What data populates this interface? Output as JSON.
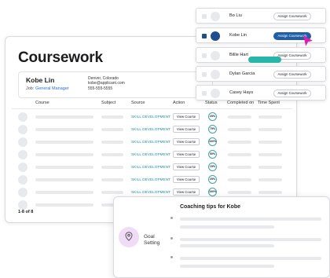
{
  "coursework": {
    "title": "Coursework",
    "profile": {
      "name": "Kobe Lin",
      "job_prefix": "Job:",
      "job_role": "General Manager",
      "location": "Denver, Colorado",
      "email": "kobe@applicant.com",
      "phone": "555-555-5555"
    },
    "columns": [
      "Course",
      "Subject",
      "Source",
      "Action",
      "Status",
      "Completed on",
      "Time Spent"
    ],
    "rows": [
      {
        "source": "SKILL DEVELOPMENT",
        "action": "View Course",
        "status": "25%"
      },
      {
        "source": "SKILL DEVELOPMENT",
        "action": "View Course",
        "status": "75%"
      },
      {
        "source": "SKILL DEVELOPMENT",
        "action": "View Course",
        "status": "100%"
      },
      {
        "source": "SKILL DEVELOPMENT",
        "action": "View Course",
        "status": "50%"
      },
      {
        "source": "SKILL DEVELOPMENT",
        "action": "View Course",
        "status": "15%"
      },
      {
        "source": "SKILL DEVELOPMENT",
        "action": "View Course",
        "status": "25%"
      },
      {
        "source": "SKILL DEVELOPMENT",
        "action": "View Course",
        "status": "100%"
      },
      {
        "source": "SKILL DEVELOPMENT",
        "action": "View Course",
        "status": "25%"
      }
    ],
    "count": "1-8 of 8"
  },
  "coaching": {
    "title": "Coaching tips for Kobe",
    "goal_label": "Goal Setting",
    "icon": "location-pin-icon"
  },
  "assign_list": [
    {
      "name": "Bo Liu",
      "button": "Assign Coursework",
      "selected": false
    },
    {
      "name": "Kobe Lin",
      "button": "Assign Coursework",
      "selected": true
    },
    {
      "name": "Billie Hart",
      "button": "Assign Coursework",
      "selected": false
    },
    {
      "name": "Dylan Garcia",
      "button": "Assign Coursework",
      "selected": false
    },
    {
      "name": "Casey Hays",
      "button": "Assign Coursework",
      "selected": false
    }
  ],
  "colors": {
    "accent_teal": "#27b6a8",
    "primary_blue": "#1f5fa6",
    "cursor_magenta": "#d81fb2",
    "goal_bg": "#f1dcf7"
  }
}
